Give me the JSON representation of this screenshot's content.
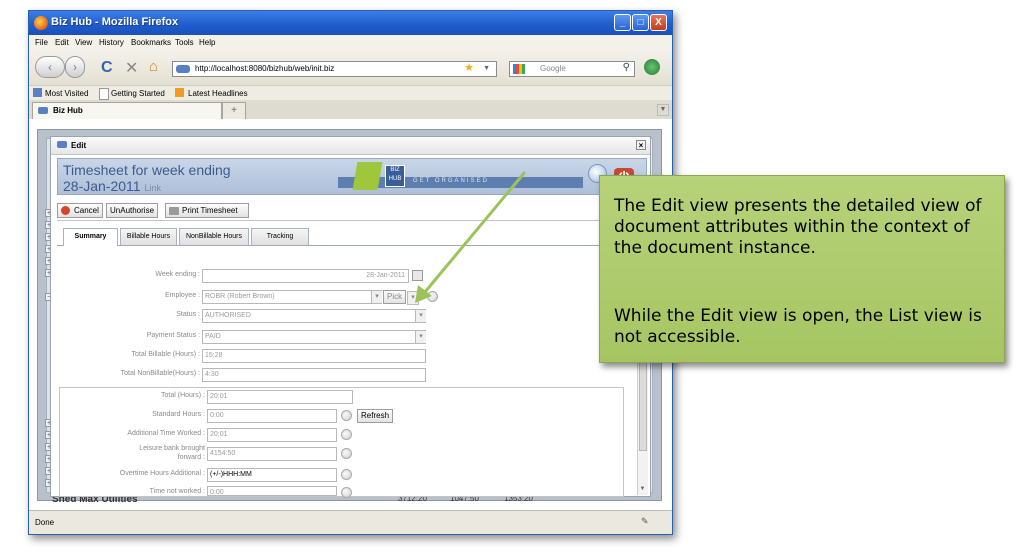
{
  "window": {
    "title": "Biz Hub - Mozilla Firefox",
    "buttons": {
      "minimize": "_",
      "maximize": "□",
      "close": "X"
    }
  },
  "menu": [
    "File",
    "Edit",
    "View",
    "History",
    "Bookmarks",
    "Tools",
    "Help"
  ],
  "nav": {
    "url": "http://localhost:8080/bizhub/web/init.biz",
    "search_placeholder": "Google"
  },
  "bookmarks": [
    "Most Visited",
    "Getting Started",
    "Latest Headlines"
  ],
  "tabs": [
    {
      "label": "Biz Hub"
    }
  ],
  "status_text": "Done",
  "background_app": {
    "shed_label": "Shed Max Utilities",
    "row_values": [
      "3712:20",
      "1047:50",
      "1353:20"
    ]
  },
  "dialog": {
    "title": "Edit",
    "banner_line1": "Timesheet for week ending",
    "banner_line2": "28-Jan-2011",
    "banner_link": "Link",
    "logo_text": "BIZ HUB",
    "slogan": "GET ORGANISED",
    "toolbar": {
      "cancel": "Cancel",
      "unauthorise": "UnAuthorise",
      "print": "Print Timesheet"
    },
    "tabs": [
      "Summary",
      "Billable Hours",
      "NonBillable Hours",
      "Tracking"
    ],
    "fields": {
      "week_ending": {
        "label": "Week ending :",
        "value": "28-Jan-2011"
      },
      "employee": {
        "label": "Employee :",
        "value": "ROBR (Robert Brown)",
        "pick": "Pick"
      },
      "status": {
        "label": "Status :",
        "value": "AUTHORISED"
      },
      "payment_status": {
        "label": "Payment Status :",
        "value": "PAID"
      },
      "total_billable": {
        "label": "Total Billable (Hours) :",
        "value": "15:28"
      },
      "total_nonbillable": {
        "label": "Total NonBillable(Hours) :",
        "value": "4:30"
      },
      "total_hours": {
        "label": "Total (Hours) :",
        "value": "20:01"
      },
      "standard_hours": {
        "label": "Standard Hours :",
        "value": "0:00",
        "button": "Refresh"
      },
      "additional_time": {
        "label": "Additional Time Worked :",
        "value": "20:01"
      },
      "leisure_bank_1": {
        "label": "Leisure bank brought"
      },
      "leisure_bank_2": {
        "label": "forward :",
        "value": "4154:50"
      },
      "overtime": {
        "label": "Overtime Hours Additional :",
        "value": "(+/-)HHH:MM"
      },
      "time_not_worked": {
        "label": "Time not worked :",
        "value": "0:00"
      }
    }
  },
  "callout": {
    "p1": "The Edit view presents the detailed view of document attributes within the context of the document instance.",
    "p2": "While the Edit view is open, the List view is not accessible."
  }
}
